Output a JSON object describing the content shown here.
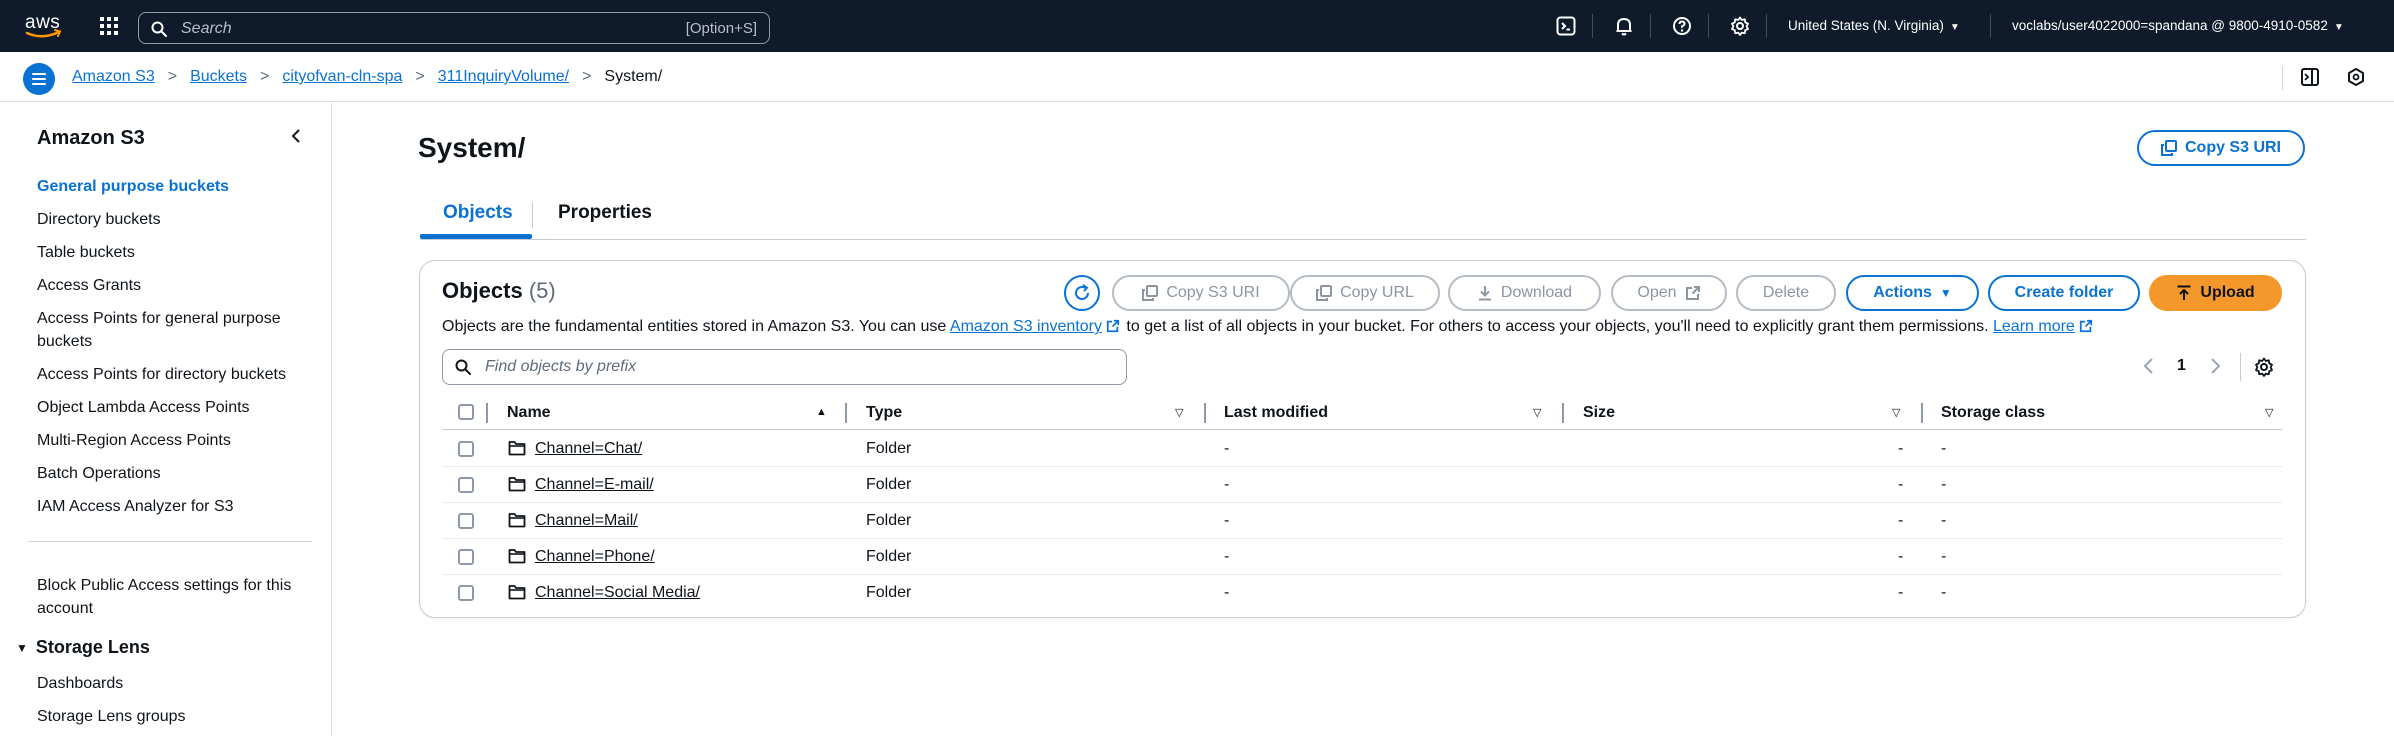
{
  "topnav": {
    "logo_text": "aws",
    "search_placeholder": "Search",
    "search_shortcut": "[Option+S]",
    "region": "United States (N. Virginia)",
    "account": "voclabs/user4022000=spandana @ 9800-4910-0582"
  },
  "breadcrumb": {
    "items": [
      "Amazon S3",
      "Buckets",
      "cityofvan-cln-spa",
      "311InquiryVolume/"
    ],
    "current": "System/"
  },
  "sidebar": {
    "title": "Amazon S3",
    "items": [
      {
        "label": "General purpose buckets",
        "active": true
      },
      {
        "label": "Directory buckets"
      },
      {
        "label": "Table buckets"
      },
      {
        "label": "Access Grants"
      },
      {
        "label": "Access Points for general purpose buckets"
      },
      {
        "label": "Access Points for directory buckets"
      },
      {
        "label": "Object Lambda Access Points"
      },
      {
        "label": "Multi-Region Access Points"
      },
      {
        "label": "Batch Operations"
      },
      {
        "label": "IAM Access Analyzer for S3"
      }
    ],
    "block_public": "Block Public Access settings for this account",
    "storage_lens": {
      "title": "Storage Lens",
      "items": [
        "Dashboards",
        "Storage Lens groups"
      ]
    }
  },
  "page": {
    "title": "System/",
    "copy_uri_label": "Copy S3 URI",
    "tabs": [
      "Objects",
      "Properties"
    ]
  },
  "objects_panel": {
    "title": "Objects",
    "count": "(5)",
    "description_pre": "Objects are the fundamental entities stored in Amazon S3. You can use",
    "inventory_link": "Amazon S3 inventory",
    "description_post": "to get a list of all objects in your bucket. For others to access your objects, you'll need to explicitly grant them permissions.",
    "learn_more": "Learn more",
    "buttons": {
      "copy_s3_uri": "Copy S3 URI",
      "copy_url": "Copy URL",
      "download": "Download",
      "open": "Open",
      "delete": "Delete",
      "actions": "Actions",
      "create_folder": "Create folder",
      "upload": "Upload"
    },
    "filter_placeholder": "Find objects by prefix",
    "page_number": "1",
    "columns": [
      "Name",
      "Type",
      "Last modified",
      "Size",
      "Storage class"
    ],
    "rows": [
      {
        "name": "Channel=Chat/",
        "type": "Folder",
        "last_modified": "-",
        "size": "-",
        "storage_class": "-"
      },
      {
        "name": "Channel=E-mail/",
        "type": "Folder",
        "last_modified": "-",
        "size": "-",
        "storage_class": "-"
      },
      {
        "name": "Channel=Mail/",
        "type": "Folder",
        "last_modified": "-",
        "size": "-",
        "storage_class": "-"
      },
      {
        "name": "Channel=Phone/",
        "type": "Folder",
        "last_modified": "-",
        "size": "-",
        "storage_class": "-"
      },
      {
        "name": "Channel=Social Media/",
        "type": "Folder",
        "last_modified": "-",
        "size": "-",
        "storage_class": "-"
      }
    ]
  },
  "colors": {
    "nav_bg": "#0f1b2a",
    "link": "#0972d3",
    "primary_button": "#f5982b"
  }
}
